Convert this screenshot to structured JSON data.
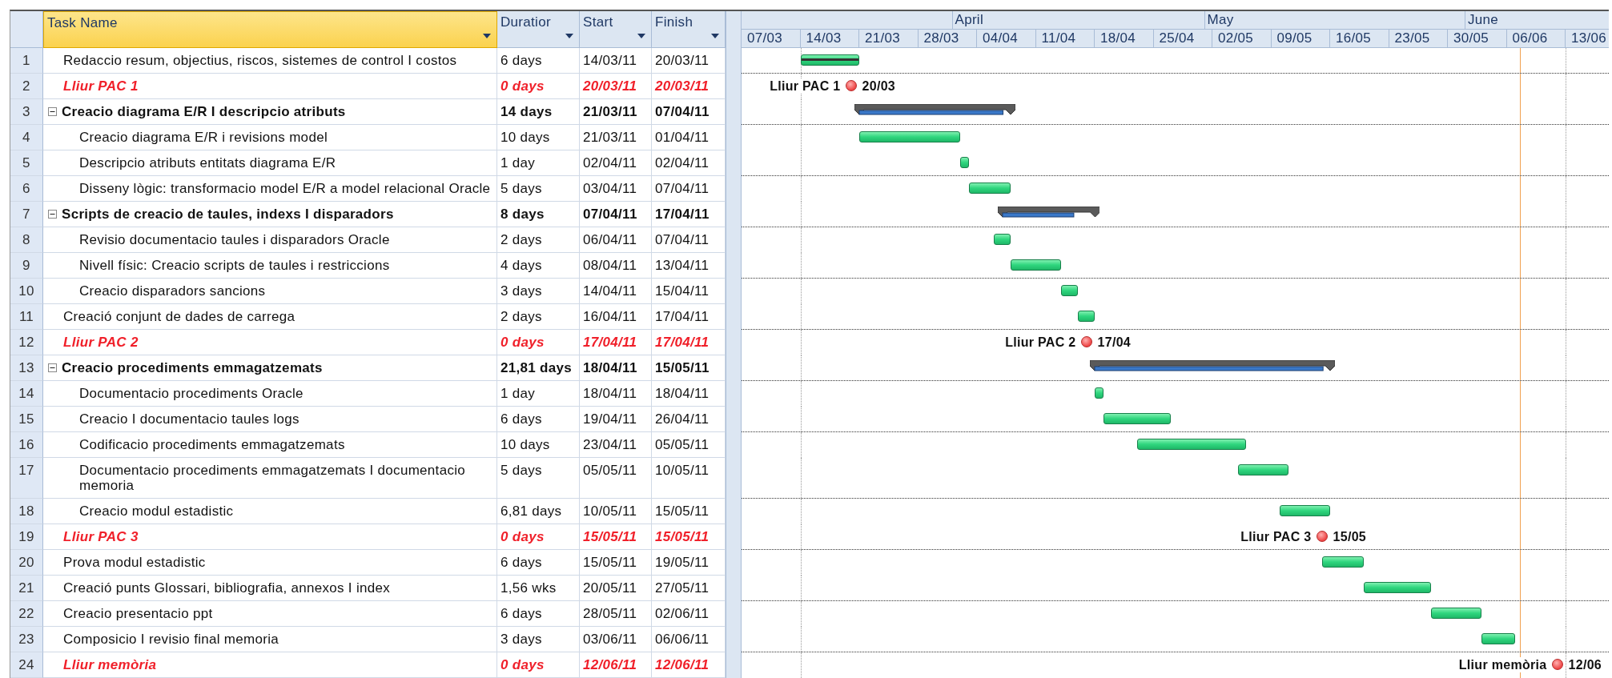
{
  "columns": [
    {
      "label": "Task Name",
      "selected": true
    },
    {
      "label": "Duratior",
      "selected": false
    },
    {
      "label": "Start",
      "selected": false
    },
    {
      "label": "Finish",
      "selected": false
    }
  ],
  "timescale": {
    "months": [
      "April",
      "May",
      "June"
    ],
    "weeks": [
      "07/03",
      "14/03",
      "21/03",
      "28/03",
      "04/04",
      "11/04",
      "18/04",
      "25/04",
      "02/05",
      "09/05",
      "16/05",
      "23/05",
      "30/05",
      "06/06",
      "13/06"
    ]
  },
  "rows": [
    {
      "num": "1",
      "kind": "task",
      "name": "Redaccio resum, objectius, riscos, sistemes de control I costos",
      "duration": "6 days",
      "start": "14/03/11",
      "finish": "20/03/11",
      "level": 1
    },
    {
      "num": "2",
      "kind": "milestone",
      "name": "Lliur PAC 1",
      "duration": "0 days",
      "start": "20/03/11",
      "finish": "20/03/11",
      "gantt_label": "Lliur PAC 1",
      "date_label": "20/03"
    },
    {
      "num": "3",
      "kind": "summary",
      "name": "Creacio diagrama E/R I descripcio atributs",
      "duration": "14 days",
      "start": "21/03/11",
      "finish": "07/04/11",
      "expanded": true,
      "level": 0.95,
      "children": [
        {
          "num": "4",
          "kind": "task",
          "name": "Creacio diagrama E/R i revisions model",
          "duration": "10 days",
          "start": "21/03/11",
          "finish": "01/04/11"
        },
        {
          "num": "5",
          "kind": "task",
          "name": "Descripcio atributs entitats diagrama E/R",
          "duration": "1 day",
          "start": "02/04/11",
          "finish": "02/04/11"
        },
        {
          "num": "6",
          "kind": "task",
          "name": "Disseny lògic: transformacio model E/R a model relacional Oracle",
          "duration": "5 days",
          "start": "03/04/11",
          "finish": "07/04/11"
        }
      ]
    },
    {
      "num": "7",
      "kind": "summary",
      "name": "Scripts de creacio de taules, indexs I disparadors",
      "duration": "8 days",
      "start": "07/04/11",
      "finish": "17/04/11",
      "expanded": true,
      "level": 0.77,
      "children": [
        {
          "num": "8",
          "kind": "task",
          "name": "Revisio documentacio taules i disparadors Oracle",
          "duration": "2 days",
          "start": "06/04/11",
          "finish": "07/04/11"
        },
        {
          "num": "9",
          "kind": "task",
          "name": "Nivell físic: Creacio scripts de taules i restriccions",
          "duration": "4 days",
          "start": "08/04/11",
          "finish": "13/04/11"
        },
        {
          "num": "10",
          "kind": "task",
          "name": "Creacio disparadors sancions",
          "duration": "3 days",
          "start": "14/04/11",
          "finish": "15/04/11"
        }
      ]
    },
    {
      "num": "11",
      "kind": "task",
      "name": "Creació conjunt de dades de carrega",
      "duration": "2 days",
      "start": "16/04/11",
      "finish": "17/04/11"
    },
    {
      "num": "12",
      "kind": "milestone",
      "name": "Lliur PAC 2",
      "duration": "0 days",
      "start": "17/04/11",
      "finish": "17/04/11",
      "gantt_label": "Lliur PAC 2",
      "date_label": "17/04"
    },
    {
      "num": "13",
      "kind": "summary",
      "name": "Creacio procediments emmagatzemats",
      "duration": "21,81 days",
      "start": "18/04/11",
      "finish": "15/05/11",
      "expanded": true,
      "level": 0.97,
      "children": [
        {
          "num": "14",
          "kind": "task",
          "name": "Documentacio procediments Oracle",
          "duration": "1 day",
          "start": "18/04/11",
          "finish": "18/04/11"
        },
        {
          "num": "15",
          "kind": "task",
          "name": "Creacio I documentacio taules logs",
          "duration": "6 days",
          "start": "19/04/11",
          "finish": "26/04/11"
        },
        {
          "num": "16",
          "kind": "task",
          "name": "Codificacio procediments emmagatzemats",
          "duration": "10 days",
          "start": "23/04/11",
          "finish": "05/05/11"
        },
        {
          "num": "17",
          "kind": "task",
          "name": "Documentacio procediments emmagatzemats I documentacio memoria",
          "duration": "5 days",
          "start": "05/05/11",
          "finish": "10/05/11"
        },
        {
          "num": "18",
          "kind": "task",
          "name": "Creacio modul estadistic",
          "duration": "6,81 days",
          "start": "10/05/11",
          "finish": "15/05/11"
        }
      ]
    },
    {
      "num": "19",
      "kind": "milestone",
      "name": "Lliur PAC 3",
      "duration": "0 days",
      "start": "15/05/11",
      "finish": "15/05/11",
      "gantt_label": "Lliur PAC 3",
      "date_label": "15/05"
    },
    {
      "num": "20",
      "kind": "task",
      "name": "Prova modul estadistic",
      "duration": "6 days",
      "start": "15/05/11",
      "finish": "19/05/11"
    },
    {
      "num": "21",
      "kind": "task",
      "name": "Creació punts Glossari, bibliografia, annexos I index",
      "duration": "1,56 wks",
      "start": "20/05/11",
      "finish": "27/05/11"
    },
    {
      "num": "22",
      "kind": "task",
      "name": "Creacio presentacio ppt",
      "duration": "6 days",
      "start": "28/05/11",
      "finish": "02/06/11"
    },
    {
      "num": "23",
      "kind": "task",
      "name": "Composicio I revisio final memoria",
      "duration": "3 days",
      "start": "03/06/11",
      "finish": "06/06/11"
    },
    {
      "num": "24",
      "kind": "milestone",
      "name": "Lliur memòria",
      "duration": "0 days",
      "start": "12/06/11",
      "finish": "12/06/11",
      "gantt_label": "Lliur memòria",
      "date_label": "12/06"
    }
  ]
}
